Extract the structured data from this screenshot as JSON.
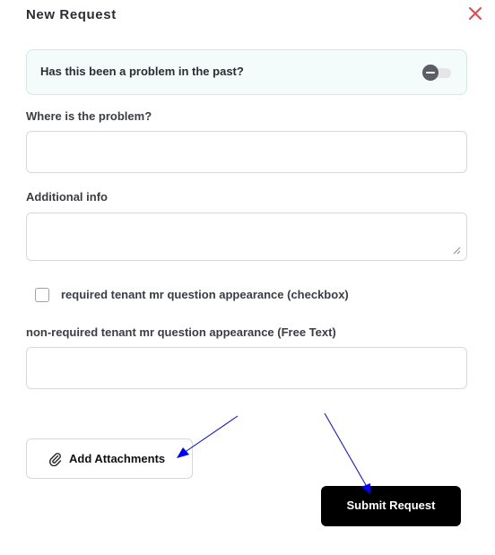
{
  "dialog": {
    "title": "New Request"
  },
  "problem_past_toggle": {
    "question": "Has this been a problem in the past?",
    "enabled": false
  },
  "fields": {
    "location_label": "Where is the problem?",
    "location_value": "",
    "additional_info_label": "Additional info",
    "additional_info_value": "",
    "checkbox_label": "required tenant mr question appearance (checkbox)",
    "checkbox_checked": false,
    "free_text_label": "non-required tenant mr question appearance (Free Text)",
    "free_text_value": ""
  },
  "actions": {
    "attach_label": "Add Attachments",
    "submit_label": "Submit Request"
  },
  "colors": {
    "close_icon": "#e5484d",
    "toggle_card_bg": "#f3fbfb",
    "toggle_card_border": "#cdeaea",
    "submit_bg": "#000000",
    "annotation_arrow": "#0000ff"
  }
}
